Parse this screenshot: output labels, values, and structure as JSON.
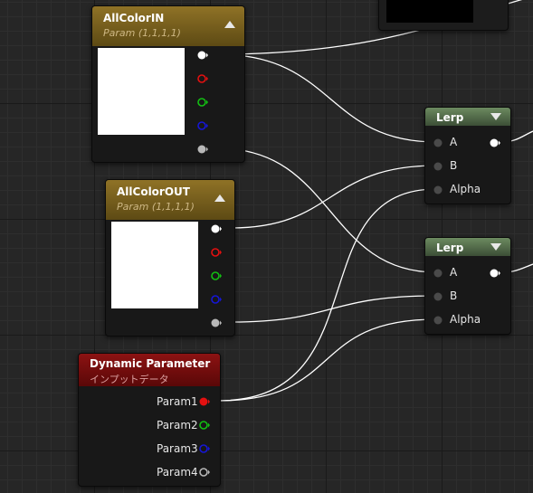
{
  "nodes": {
    "allcolor_in": {
      "title": "AllColorIN",
      "subtitle": "Param (1,1,1,1)"
    },
    "allcolor_out": {
      "title": "AllColorOUT",
      "subtitle": "Param (1,1,1,1)"
    },
    "lerp_top": {
      "title": "Lerp",
      "inputs": [
        "A",
        "B",
        "Alpha"
      ]
    },
    "lerp_bottom": {
      "title": "Lerp",
      "inputs": [
        "A",
        "B",
        "Alpha"
      ]
    },
    "dynamic_parameter": {
      "title": "Dynamic Parameter",
      "subtitle": "インプットデータ",
      "outputs": [
        "Param1",
        "Param2",
        "Param3",
        "Param4"
      ]
    }
  },
  "colors": {
    "background": "#262626",
    "pin_white": "#ffffff",
    "pin_red": "#e41010",
    "pin_green": "#13c013",
    "pin_blue": "#1616d8",
    "pin_gray": "#b8b8b8",
    "wire": "#ffffff"
  }
}
